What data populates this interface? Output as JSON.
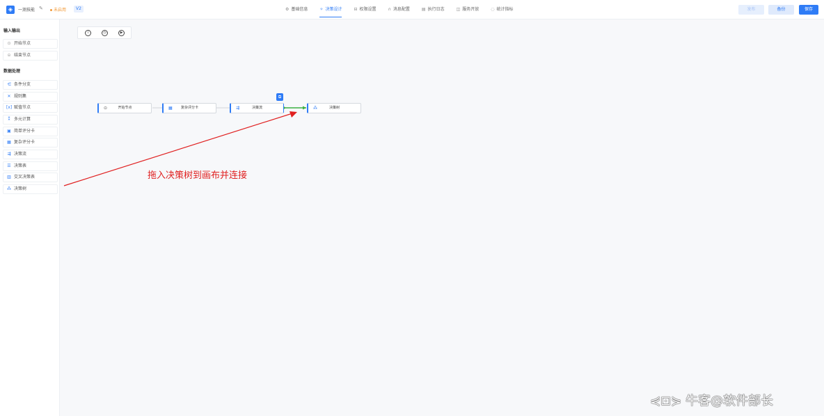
{
  "header": {
    "app_name": "一测技能",
    "status": "未启用",
    "version": "V2",
    "tabs": [
      {
        "label": "基础信息",
        "icon": "gear-icon"
      },
      {
        "label": "决策设计",
        "icon": "design-icon",
        "active": true
      },
      {
        "label": "权限设置",
        "icon": "lock-icon"
      },
      {
        "label": "消息配置",
        "icon": "headset-icon"
      },
      {
        "label": "执行日志",
        "icon": "log-icon"
      },
      {
        "label": "服务开放",
        "icon": "service-icon"
      },
      {
        "label": "统计指标",
        "icon": "shield-icon"
      }
    ],
    "publish_label": "发布",
    "backup_label": "备份",
    "save_label": "保存"
  },
  "sidebar": {
    "section_io": "输入输出",
    "io_items": [
      {
        "label": "开始节点",
        "icon": "start-icon"
      },
      {
        "label": "结束节点",
        "icon": "end-icon"
      }
    ],
    "section_data": "数据处理",
    "data_items": [
      {
        "label": "条件分支",
        "icon": "branch-icon"
      },
      {
        "label": "规则集",
        "icon": "rule-set-icon"
      },
      {
        "label": "赋值节点",
        "icon": "assign-icon"
      },
      {
        "label": "多元计算",
        "icon": "compute-icon"
      },
      {
        "label": "简单评分卡",
        "icon": "simple-scorecard-icon"
      },
      {
        "label": "复杂评分卡",
        "icon": "complex-scorecard-icon"
      },
      {
        "label": "决策流",
        "icon": "decision-flow-icon"
      },
      {
        "label": "决策表",
        "icon": "decision-table-icon"
      },
      {
        "label": "交叉决策表",
        "icon": "cross-table-icon"
      },
      {
        "label": "决策树",
        "icon": "decision-tree-icon"
      }
    ]
  },
  "canvas": {
    "toolbar": [
      "info-icon",
      "clock-icon",
      "play-icon"
    ],
    "nodes": [
      {
        "label": "开始节点",
        "icon": "start-icon"
      },
      {
        "label": "复杂评分卡",
        "icon": "complex-scorecard-icon"
      },
      {
        "label": "决策流",
        "icon": "decision-flow-icon"
      },
      {
        "label": "决策树",
        "icon": "decision-tree-icon"
      }
    ],
    "annotation": "拖入决策树到画布并连接",
    "watermark": "牛客@软件部长"
  },
  "colors": {
    "accent": "#2f7cf6",
    "annotation": "#e02020",
    "connector": "#3cb043",
    "status": "#f29a38"
  }
}
